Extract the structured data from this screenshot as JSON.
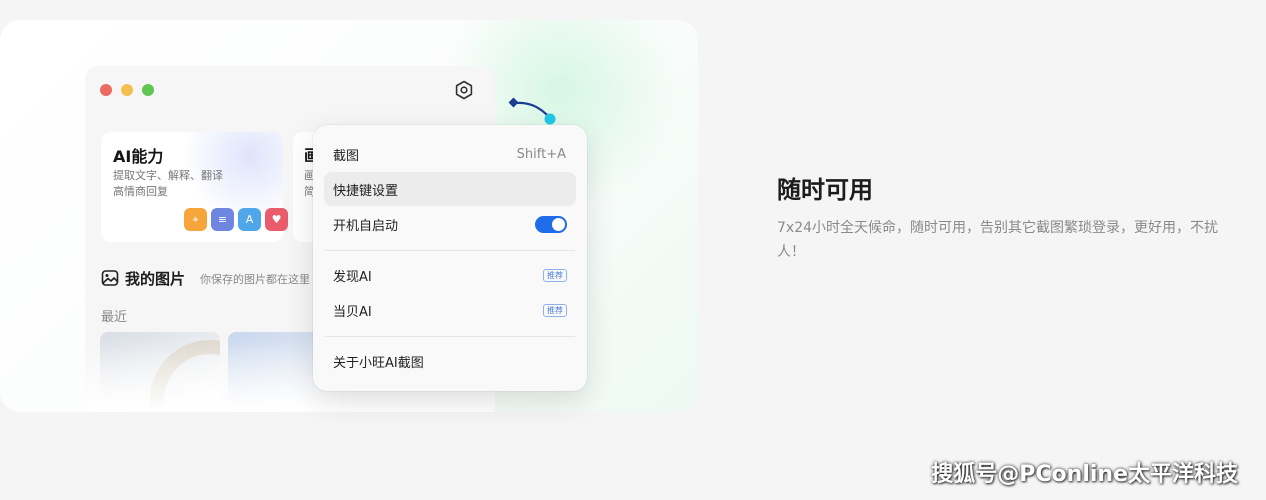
{
  "app": {
    "ai_card": {
      "title": "AI能力",
      "desc_line1": "提取文字、解释、翻译",
      "desc_line2": "高情商回复",
      "icons": [
        {
          "name": "scan-text-icon",
          "color": "#f5a53a",
          "glyph": "⌖"
        },
        {
          "name": "text-extract-icon",
          "color": "#6f86e0",
          "glyph": "≡"
        },
        {
          "name": "translate-icon",
          "color": "#4fa6e8",
          "glyph": "A"
        },
        {
          "name": "reply-icon",
          "color": "#ea5c6c",
          "glyph": "♥"
        }
      ]
    },
    "draw_card": {
      "title": "画",
      "desc_line1": "画",
      "desc_line2": "简"
    },
    "gallery": {
      "title": "我的图片",
      "hint": "你保存的图片都在这里",
      "recent_label": "最近"
    }
  },
  "menu": {
    "screenshot": {
      "label": "截图",
      "shortcut": "Shift+A"
    },
    "hotkey_settings": {
      "label": "快捷键设置"
    },
    "autostart": {
      "label": "开机自启动",
      "enabled": true
    },
    "discover_ai": {
      "label": "发现AI",
      "badge": "推荐"
    },
    "dangbei_ai": {
      "label": "当贝AI",
      "badge": "推荐"
    },
    "about": {
      "label": "关于小旺AI截图"
    }
  },
  "section": {
    "title": "随时可用",
    "description": "7x24小时全天候命，随时可用，告别其它截图繁琐登录，更好用，不扰人！"
  },
  "watermark": "搜狐号@PConline太平洋科技",
  "colors": {
    "accent": "#1e6ce8",
    "connector": "#1fc8e6"
  }
}
